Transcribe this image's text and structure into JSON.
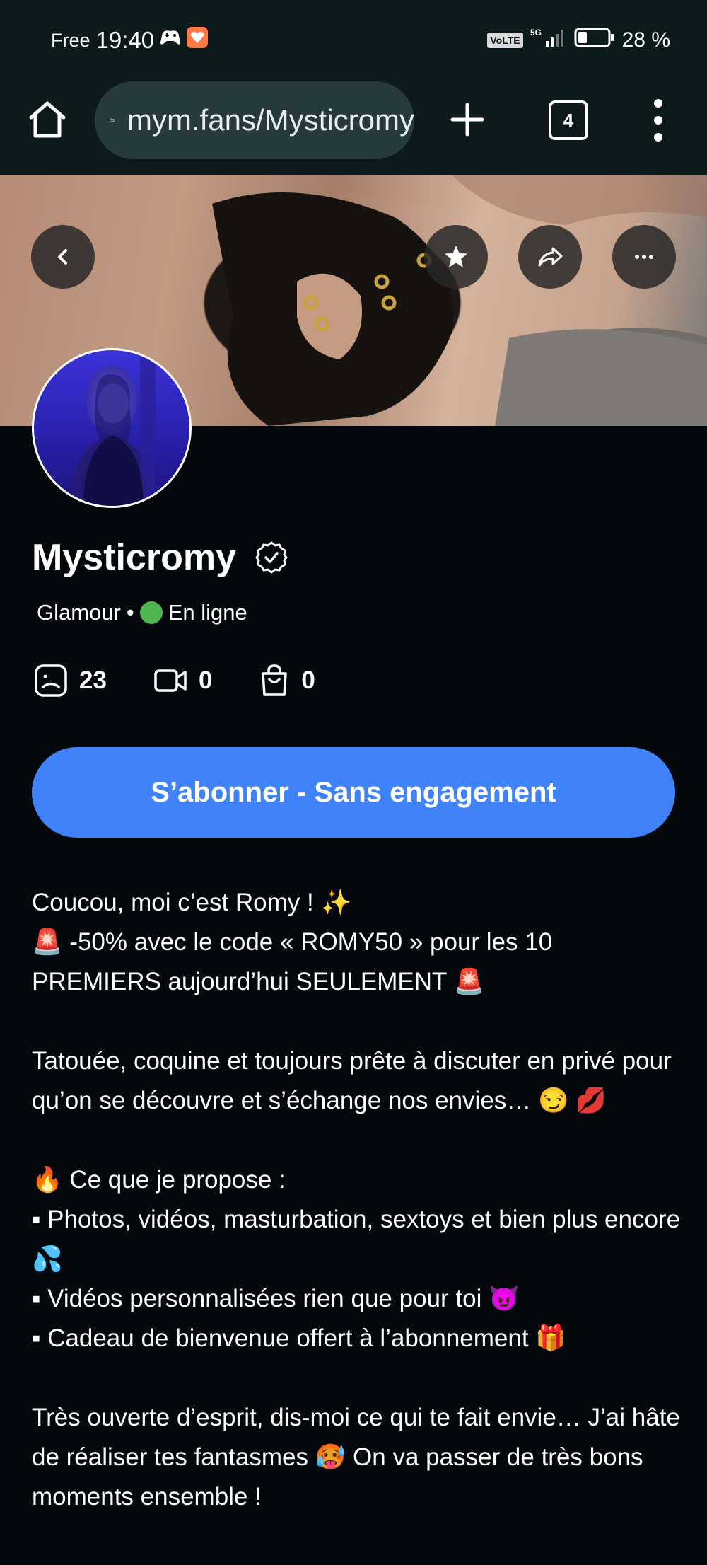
{
  "status_bar": {
    "carrier": "Free",
    "time": "19:40",
    "volte": "VoLTE",
    "network": "5G",
    "battery": "28 %"
  },
  "browser": {
    "url": "mym.fans/Mysticromy",
    "tab_count": "4"
  },
  "profile": {
    "name": "Mysticromy",
    "category": "Glamour",
    "separator": "•",
    "status": "En ligne",
    "stats": {
      "posts": "23",
      "videos": "0",
      "shop": "0"
    },
    "subscribe_label": "S’abonner - Sans engagement"
  },
  "bio": {
    "line1": "Coucou, moi c’est Romy ! ✨",
    "line2": "🚨 -50% avec le code « ROMY50 » pour les 10 PREMIERS aujourd’hui SEULEMENT 🚨",
    "line3": "Tatouée, coquine et toujours prête à discuter en privé pour qu’on se découvre et s’échange nos envies… 😏 💋",
    "line4": "🔥 Ce que je propose :",
    "line5": "▪ Photos, vidéos, masturbation, sextoys et bien plus encore 💦",
    "line6": "▪ Vidéos personnalisées rien que pour toi 😈",
    "line7": "▪ Cadeau de bienvenue offert à l’abonnement 🎁",
    "line8": "Très ouverte d’esprit, dis-moi ce qui te fait envie… J’ai hâte de réaliser tes fantasmes 🥵 On va passer de très bons moments ensemble !"
  },
  "colors": {
    "background": "#04080c",
    "browser_chrome": "#0c1a1b",
    "urlbar": "#273a3b",
    "cta": "#3f82fa",
    "online": "#4fb64f"
  }
}
